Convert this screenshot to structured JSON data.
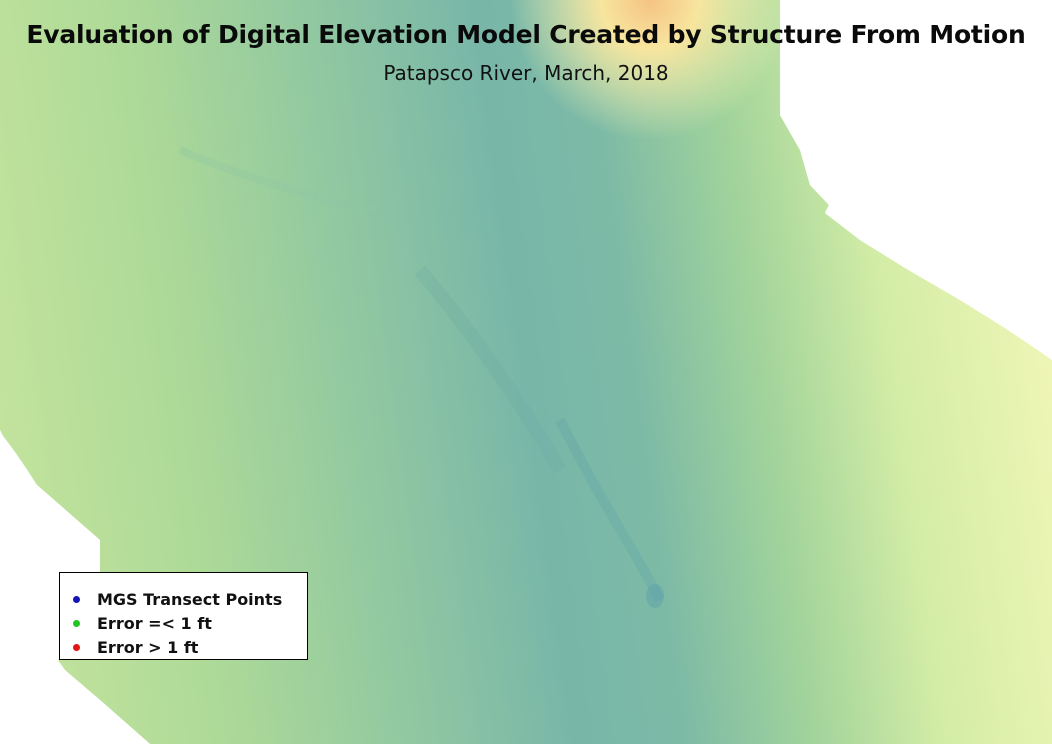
{
  "map": {
    "title": "Evaluation of Digital Elevation Model Created by Structure From Motion",
    "subtitle": "Patapsco River, March, 2018",
    "colors": {
      "background": "#ffffff",
      "low_elevation": "#6fada9",
      "mid_low": "#8ec3a5",
      "mid": "#aad99a",
      "high": "#dff0a8",
      "highest": "#f5f5b5",
      "peak": "#f6c383"
    }
  },
  "legend": {
    "items": [
      {
        "label": "MGS Transect Points",
        "color": "#1414b4",
        "icon": "blue-dot-icon"
      },
      {
        "label": "Error =< 1 ft",
        "color": "#22c422",
        "icon": "green-dot-icon"
      },
      {
        "label": "Error > 1 ft",
        "color": "#e01414",
        "icon": "red-dot-icon"
      }
    ]
  }
}
